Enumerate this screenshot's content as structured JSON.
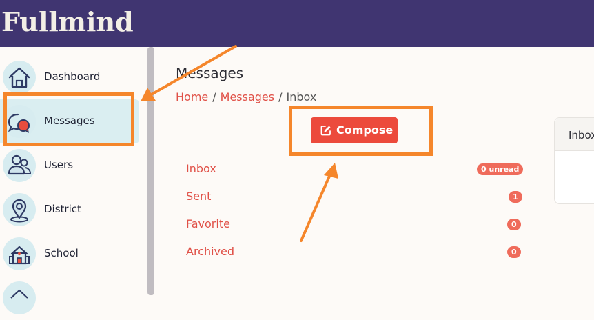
{
  "header": {
    "brand": "Fullmind"
  },
  "sidebar": {
    "items": [
      {
        "label": "Dashboard",
        "icon": "house-icon"
      },
      {
        "label": "Messages",
        "icon": "chat-bubbles-icon",
        "active": true
      },
      {
        "label": "Users",
        "icon": "users-icon"
      },
      {
        "label": "District",
        "icon": "map-pin-icon"
      },
      {
        "label": "School",
        "icon": "school-building-icon"
      }
    ]
  },
  "main": {
    "title": "Messages",
    "breadcrumb": {
      "home": "Home",
      "messages": "Messages",
      "current": "Inbox",
      "separator": "/"
    },
    "compose_label": "Compose",
    "folders": [
      {
        "name": "Inbox",
        "badge": "0 unread"
      },
      {
        "name": "Sent",
        "badge": "1"
      },
      {
        "name": "Favorite",
        "badge": "0"
      },
      {
        "name": "Archived",
        "badge": "0"
      }
    ],
    "panel_title": "Inbox"
  },
  "colors": {
    "header_bg": "#403571",
    "accent": "#ec4a3c",
    "link": "#e05047",
    "active_nav": "#daeef1",
    "annotation": "#f5862b"
  }
}
